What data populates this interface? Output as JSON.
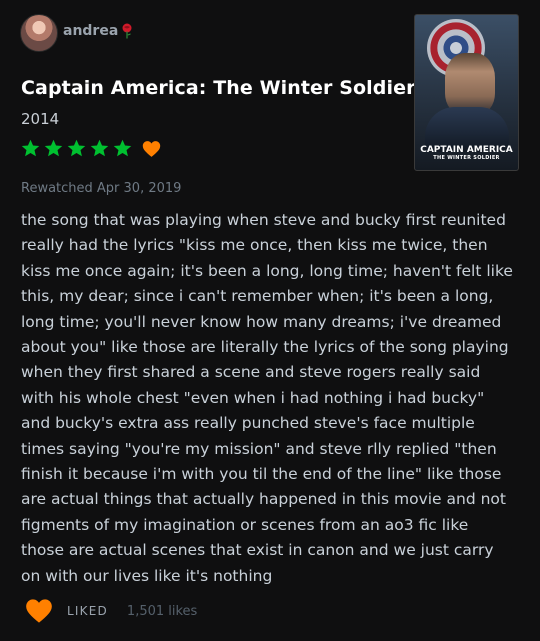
{
  "user": {
    "username": "andrea",
    "emoji_icon": "rose-icon"
  },
  "film": {
    "title": "Captain America: The Winter Soldier",
    "year": "2014",
    "poster": {
      "title": "CAPTAIN AMERICA",
      "subtitle": "THE WINTER SOLDIER"
    }
  },
  "rating": {
    "stars": 5,
    "max": 5,
    "liked": true
  },
  "entry": {
    "watched_label": "Rewatched Apr 30, 2019"
  },
  "review": {
    "text": "the song that was playing when steve and bucky first reunited really had the lyrics \"kiss me once, then kiss me twice, then kiss me once again; it's been a long, long time; haven't felt like this, my dear; since i can't remember when; it's been a long, long time; you'll never know how many dreams; i've dreamed about you\" like those are literally the lyrics of the song playing when they first shared a scene and steve rogers really said with his whole chest \"even when i had nothing i had bucky\" and bucky's extra ass really punched steve's face multiple times saying \"you're my mission\" and steve rlly replied \"then finish it because i'm with you til the end of the line\" like those are actual things that actually happened in this movie and not figments of my imagination or scenes from an ao3 fic like those are actual scenes that exist in canon and we just carry on with our lives like it's nothing"
  },
  "footer": {
    "liked_label": "LIKED",
    "likes_count": "1,501 likes"
  },
  "colors": {
    "star": "#00c030",
    "heart": "#ff8000",
    "background": "#0f0f10"
  }
}
